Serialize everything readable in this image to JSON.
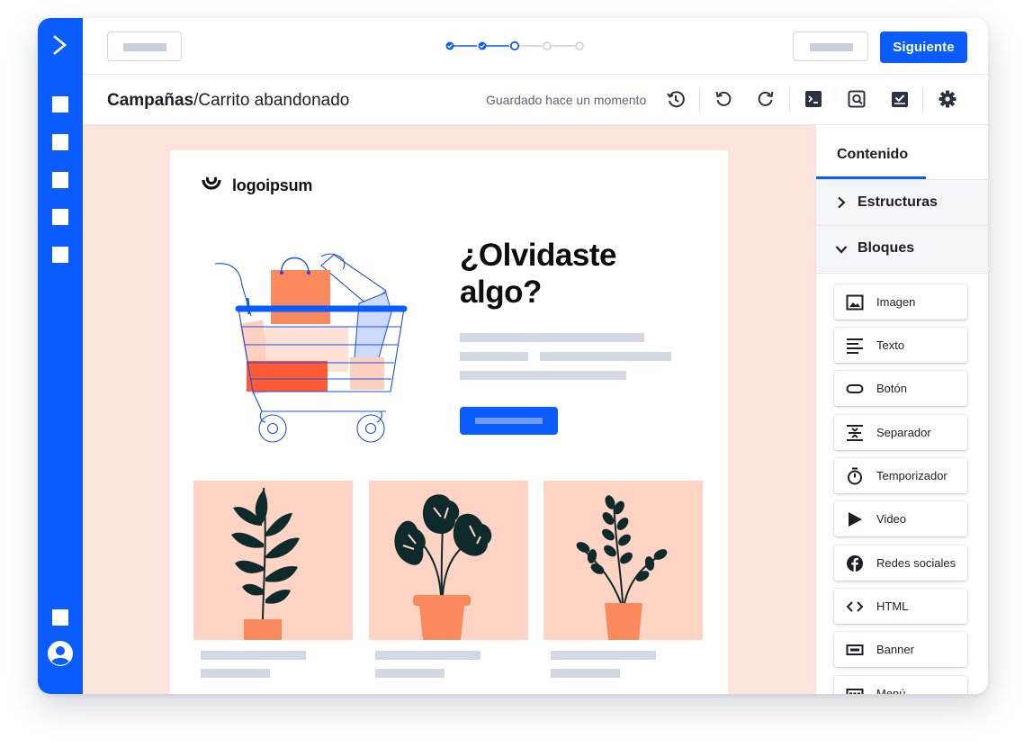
{
  "topbar": {
    "next_label": "Siguiente",
    "steps": [
      {
        "state": "done"
      },
      {
        "state": "done"
      },
      {
        "state": "current"
      },
      {
        "state": "todo"
      },
      {
        "state": "todo"
      }
    ]
  },
  "subbar": {
    "breadcrumb_root": "Campañas",
    "breadcrumb_sep": "/",
    "breadcrumb_current": "Carrito abandonado",
    "saved_status": "Guardado hace un momento",
    "tools": [
      "history-icon",
      "undo-icon",
      "redo-icon",
      "code-preview-icon",
      "preview-icon",
      "test-check-icon",
      "settings-icon"
    ]
  },
  "email": {
    "brand": "logoipsum",
    "headline_line1": "¿Olvidaste",
    "headline_line2": "algo?"
  },
  "panel": {
    "tab_label": "Contenido",
    "section_structures": "Estructuras",
    "section_blocks": "Bloques",
    "blocks": [
      {
        "label": "Imagen",
        "icon": "image-icon"
      },
      {
        "label": "Texto",
        "icon": "text-icon"
      },
      {
        "label": "Botón",
        "icon": "button-icon"
      },
      {
        "label": "Separador",
        "icon": "separator-icon"
      },
      {
        "label": "Temporizador",
        "icon": "timer-icon"
      },
      {
        "label": "Video",
        "icon": "video-icon"
      },
      {
        "label": "Redes sociales",
        "icon": "social-icon"
      },
      {
        "label": "HTML",
        "icon": "html-icon"
      },
      {
        "label": "Banner",
        "icon": "banner-icon"
      },
      {
        "label": "Menú",
        "icon": "menu-icon"
      }
    ]
  },
  "colors": {
    "accent": "#0a5cff",
    "canvas_bg": "#fde5dd",
    "product_bg": "#ffd4c5",
    "pot": "#fa8a5e",
    "leaf": "#0f2a2a"
  }
}
